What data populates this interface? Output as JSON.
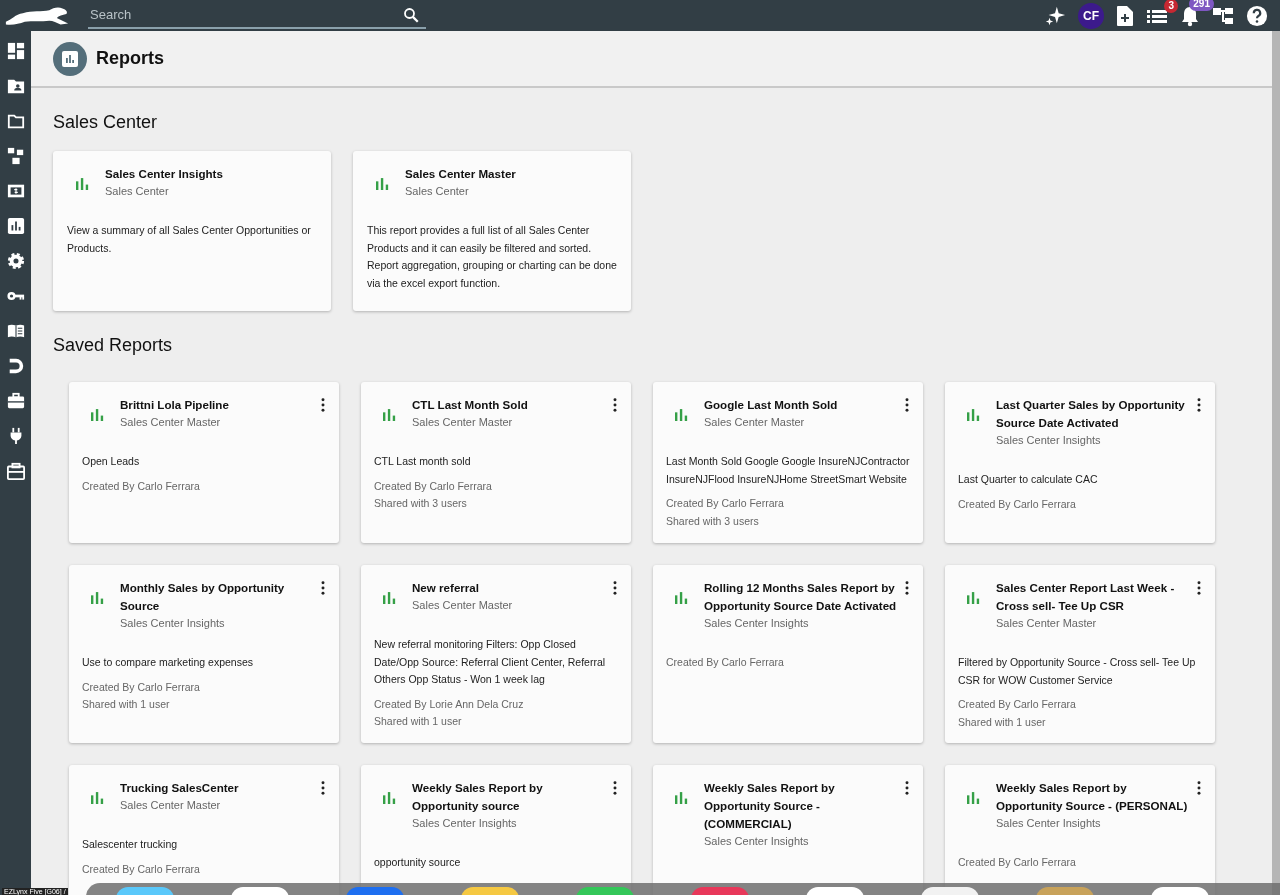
{
  "topbar": {
    "search": {
      "placeholder": "Search"
    },
    "avatar": "CF",
    "badges": {
      "tasks": "3",
      "notifications": "291"
    }
  },
  "page": {
    "title": "Reports"
  },
  "sales_center": {
    "heading": "Sales Center",
    "cards": [
      {
        "title": "Sales Center Insights",
        "source": "Sales Center",
        "description": "View a summary of all Sales Center Opportunities or Products."
      },
      {
        "title": "Sales Center Master",
        "source": "Sales Center",
        "description": "This report provides a full list of all Sales Center Products and it can easily be filtered and sorted. Report aggregation, grouping or charting can be done via the excel export function."
      }
    ]
  },
  "saved_reports": {
    "heading": "Saved Reports",
    "cards": [
      {
        "title": "Brittni Lola Pipeline",
        "source": "Sales Center Master",
        "description": "Open Leads",
        "created": "Created By Carlo Ferrara"
      },
      {
        "title": "CTL Last Month Sold",
        "source": "Sales Center Master",
        "description": "CTL Last month sold",
        "created": "Created By Carlo Ferrara",
        "shared": "Shared with 3 users"
      },
      {
        "title": "Google Last Month Sold",
        "source": "Sales Center Master",
        "description": "Last Month Sold Google Google InsureNJContractor InsureNJFlood InsureNJHome StreetSmart Website",
        "created": "Created By Carlo Ferrara",
        "shared": "Shared with 3 users"
      },
      {
        "title": "Last Quarter Sales by Opportunity Source Date Activated",
        "source": "Sales Center Insights",
        "description": "Last Quarter to calculate CAC",
        "created": "Created By Carlo Ferrara"
      },
      {
        "title": "Monthly Sales by Opportunity Source",
        "source": "Sales Center Insights",
        "description": "Use to compare marketing expenses",
        "created": "Created By Carlo Ferrara",
        "shared": "Shared with 1 user"
      },
      {
        "title": "New referral",
        "source": "Sales Center Master",
        "description": "New referral monitoring Filters: Opp Closed Date/Opp Source: Referral Client Center, Referral Others Opp Status - Won 1 week lag",
        "created": "Created By Lorie Ann Dela Cruz",
        "shared": "Shared with 1 user"
      },
      {
        "title": "Rolling 12 Months Sales Report by Opportunity Source Date Activated",
        "source": "Sales Center Insights",
        "created": "Created By Carlo Ferrara"
      },
      {
        "title": "Sales Center Report Last Week - Cross sell- Tee Up CSR",
        "source": "Sales Center Master",
        "description": "Filtered by Opportunity Source - Cross sell- Tee Up CSR for WOW Customer Service",
        "created": "Created By Carlo Ferrara",
        "shared": "Shared with 1 user"
      },
      {
        "title": "Trucking SalesCenter",
        "source": "Sales Center Master",
        "description": "Salescenter trucking",
        "created": "Created By Carlo Ferrara"
      },
      {
        "title": "Weekly Sales Report by Opportunity source",
        "source": "Sales Center Insights",
        "description": "opportunity source"
      },
      {
        "title": "Weekly Sales Report by Opportunity Source - (COMMERCIAL)",
        "source": "Sales Center Insights"
      },
      {
        "title": "Weekly Sales Report by Opportunity Source - (PERSONAL)",
        "source": "Sales Center Insights",
        "created": "Created By Carlo Ferrara"
      }
    ]
  },
  "status_text": "EZLynx Five [G06] /"
}
